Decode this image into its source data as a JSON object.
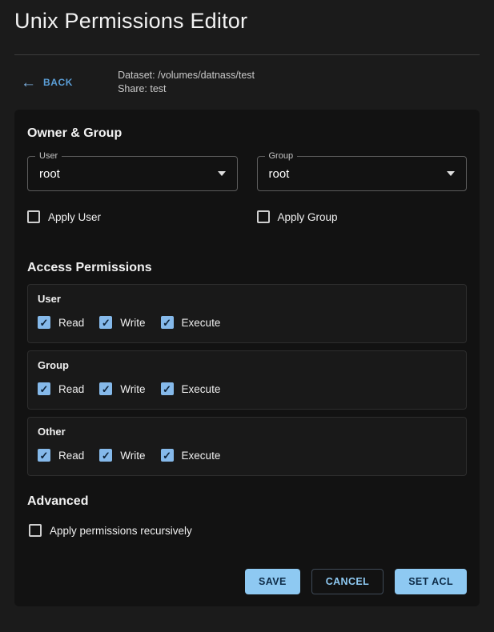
{
  "page": {
    "title": "Unix Permissions Editor"
  },
  "toolbar": {
    "back_label": "BACK",
    "dataset_line": "Dataset: /volumes/datnass/test",
    "share_line": "Share: test"
  },
  "icons": {
    "back_arrow": "←"
  },
  "owner_group": {
    "heading": "Owner & Group",
    "user_select": {
      "label": "User",
      "value": "root"
    },
    "group_select": {
      "label": "Group",
      "value": "root"
    },
    "apply_user": {
      "label": "Apply User",
      "checked": false
    },
    "apply_group": {
      "label": "Apply Group",
      "checked": false
    }
  },
  "access": {
    "heading": "Access Permissions",
    "groups": [
      {
        "name": "User",
        "perms": [
          {
            "label": "Read",
            "checked": true
          },
          {
            "label": "Write",
            "checked": true
          },
          {
            "label": "Execute",
            "checked": true
          }
        ]
      },
      {
        "name": "Group",
        "perms": [
          {
            "label": "Read",
            "checked": true
          },
          {
            "label": "Write",
            "checked": true
          },
          {
            "label": "Execute",
            "checked": true
          }
        ]
      },
      {
        "name": "Other",
        "perms": [
          {
            "label": "Read",
            "checked": true
          },
          {
            "label": "Write",
            "checked": true
          },
          {
            "label": "Execute",
            "checked": true
          }
        ]
      }
    ]
  },
  "advanced": {
    "heading": "Advanced",
    "recursive": {
      "label": "Apply permissions recursively",
      "checked": false
    }
  },
  "actions": {
    "save_label": "SAVE",
    "cancel_label": "CANCEL",
    "set_acl_label": "SET ACL"
  },
  "colors": {
    "accent_blue": "#8ec9f2",
    "checkbox_blue": "#85b9ea",
    "link_blue": "#5b9fd8",
    "button_text": "#0d2b47",
    "page_bg": "#1b1b1b",
    "card_bg": "#121212"
  }
}
